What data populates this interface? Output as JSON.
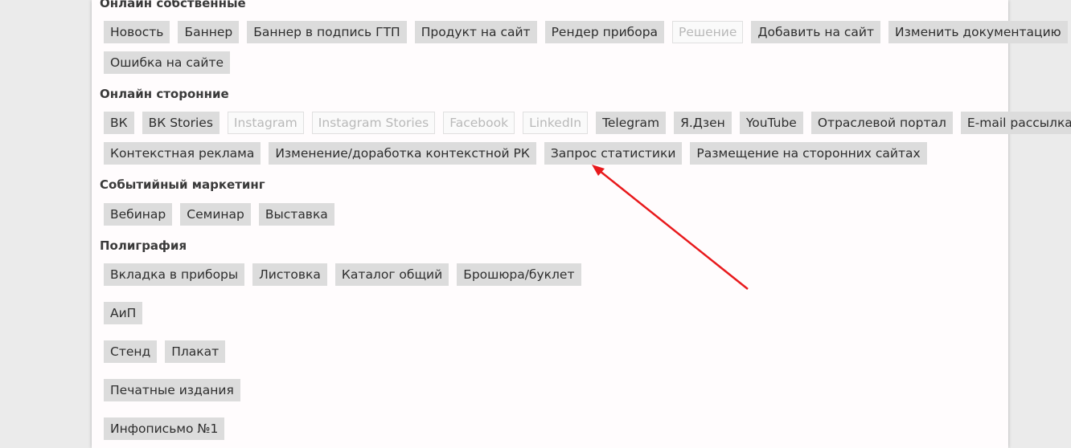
{
  "sections": [
    {
      "title": "Онлайн собственные",
      "rows": [
        [
          {
            "label": "Новость",
            "disabled": false
          },
          {
            "label": "Баннер",
            "disabled": false
          },
          {
            "label": "Баннер в подпись ГТП",
            "disabled": false
          },
          {
            "label": "Продукт на сайт",
            "disabled": false
          },
          {
            "label": "Рендер прибора",
            "disabled": false
          },
          {
            "label": "Решение",
            "disabled": true
          },
          {
            "label": "Добавить на сайт",
            "disabled": false
          },
          {
            "label": "Изменить документацию",
            "disabled": false
          }
        ],
        [
          {
            "label": "Ошибка на сайте",
            "disabled": false
          }
        ]
      ]
    },
    {
      "title": "Онлайн сторонние",
      "rows": [
        [
          {
            "label": "ВК",
            "disabled": false
          },
          {
            "label": "ВК Stories",
            "disabled": false
          },
          {
            "label": "Instagram",
            "disabled": true
          },
          {
            "label": "Instagram Stories",
            "disabled": true
          },
          {
            "label": "Facebook",
            "disabled": true
          },
          {
            "label": "LinkedIn",
            "disabled": true
          },
          {
            "label": "Telegram",
            "disabled": false
          },
          {
            "label": "Я.Дзен",
            "disabled": false
          },
          {
            "label": "YouTube",
            "disabled": false
          },
          {
            "label": "Отраслевой портал",
            "disabled": false
          },
          {
            "label": "E-mail рассылка",
            "disabled": false
          }
        ],
        [
          {
            "label": "Контекстная реклама",
            "disabled": false
          },
          {
            "label": "Изменение/доработка контекстной РК",
            "disabled": false
          },
          {
            "label": "Запрос статистики",
            "disabled": false
          },
          {
            "label": "Размещение на сторонних сайтах",
            "disabled": false
          }
        ]
      ]
    },
    {
      "title": "Событийный маркетинг",
      "rows": [
        [
          {
            "label": "Вебинар",
            "disabled": false
          },
          {
            "label": "Семинар",
            "disabled": false
          },
          {
            "label": "Выставка",
            "disabled": false
          }
        ]
      ]
    },
    {
      "title": "Полиграфия",
      "rows": [
        [
          {
            "label": "Вкладка в приборы",
            "disabled": false
          },
          {
            "label": "Листовка",
            "disabled": false
          },
          {
            "label": "Каталог общий",
            "disabled": false
          },
          {
            "label": "Брошюра/буклет",
            "disabled": false
          }
        ],
        [
          {
            "label": "АиП",
            "disabled": false
          }
        ],
        [
          {
            "label": "Стенд",
            "disabled": false
          },
          {
            "label": "Плакат",
            "disabled": false
          }
        ],
        [
          {
            "label": "Печатные издания",
            "disabled": false
          }
        ],
        [
          {
            "label": "Инфописьмо №1",
            "disabled": false
          }
        ]
      ]
    }
  ],
  "colors": {
    "annotation_arrow": "#e8191c",
    "tag_bg": "#dcdcdc",
    "tag_disabled_text": "#b9b9b9"
  }
}
